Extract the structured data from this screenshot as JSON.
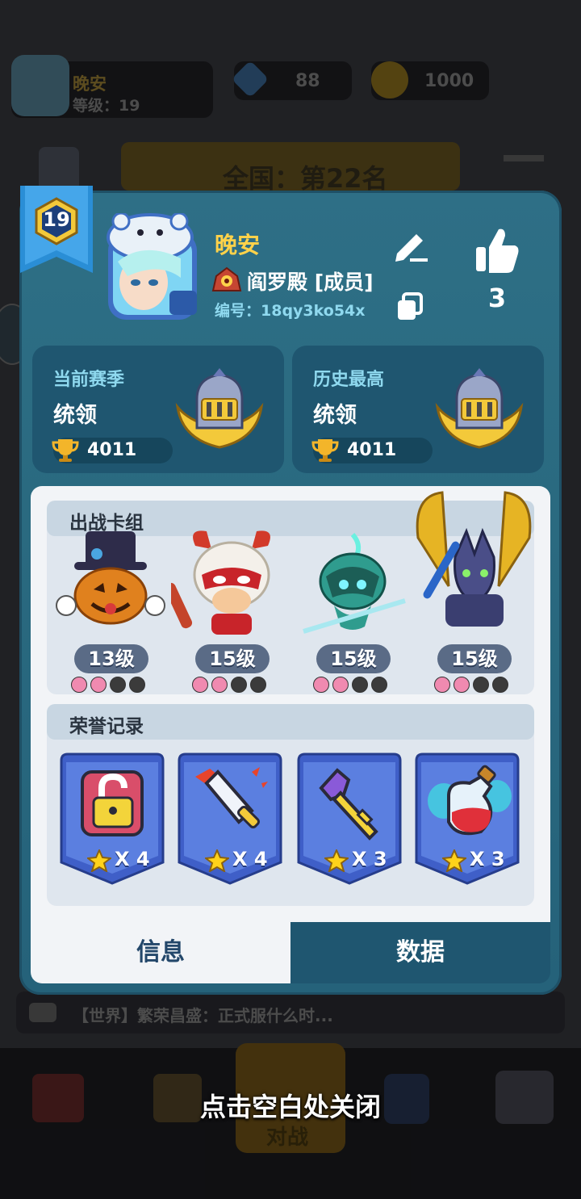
{
  "background": {
    "player_name": "晚安",
    "player_level_text": "等级：19",
    "gems": "88",
    "coins": "1000",
    "rank_text": "全国：第22名",
    "chat_text": "【世界】繁荣昌盛：正式服什么时...",
    "battle_label": "对战"
  },
  "profile": {
    "level": "19",
    "name": "晚安",
    "guild": "阎罗殿 [成员]",
    "id_text": "编号：18qy3ko54x",
    "likes": "3"
  },
  "stats": {
    "current_season": {
      "title": "当前赛季",
      "rank": "统领",
      "trophies": "4011"
    },
    "history_best": {
      "title": "历史最高",
      "rank": "统领",
      "trophies": "4011"
    }
  },
  "deck": {
    "title": "出战卡组",
    "cards": [
      {
        "name": "pumpkin-gentleman",
        "level": "13级",
        "stars": 2
      },
      {
        "name": "monkey-king",
        "level": "15级",
        "stars": 2
      },
      {
        "name": "ghost-knight",
        "level": "15级",
        "stars": 2
      },
      {
        "name": "anubis",
        "level": "15级",
        "stars": 2
      }
    ]
  },
  "honor": {
    "title": "荣誉记录",
    "items": [
      {
        "icon": "lock-icon",
        "count": "X 4"
      },
      {
        "icon": "sword-icon",
        "count": "X 4"
      },
      {
        "icon": "key-icon",
        "count": "X 3"
      },
      {
        "icon": "potion-icon",
        "count": "X 3"
      }
    ]
  },
  "tabs": {
    "info": "信息",
    "data": "数据"
  },
  "close_hint": "点击空白处关闭",
  "colors": {
    "popup_bg": "#2a6a80",
    "card_bg": "#1f5670",
    "panel_bg": "#f2f4f7",
    "accent_text": "#8fd9ef",
    "name_gold": "#ffd24a"
  }
}
